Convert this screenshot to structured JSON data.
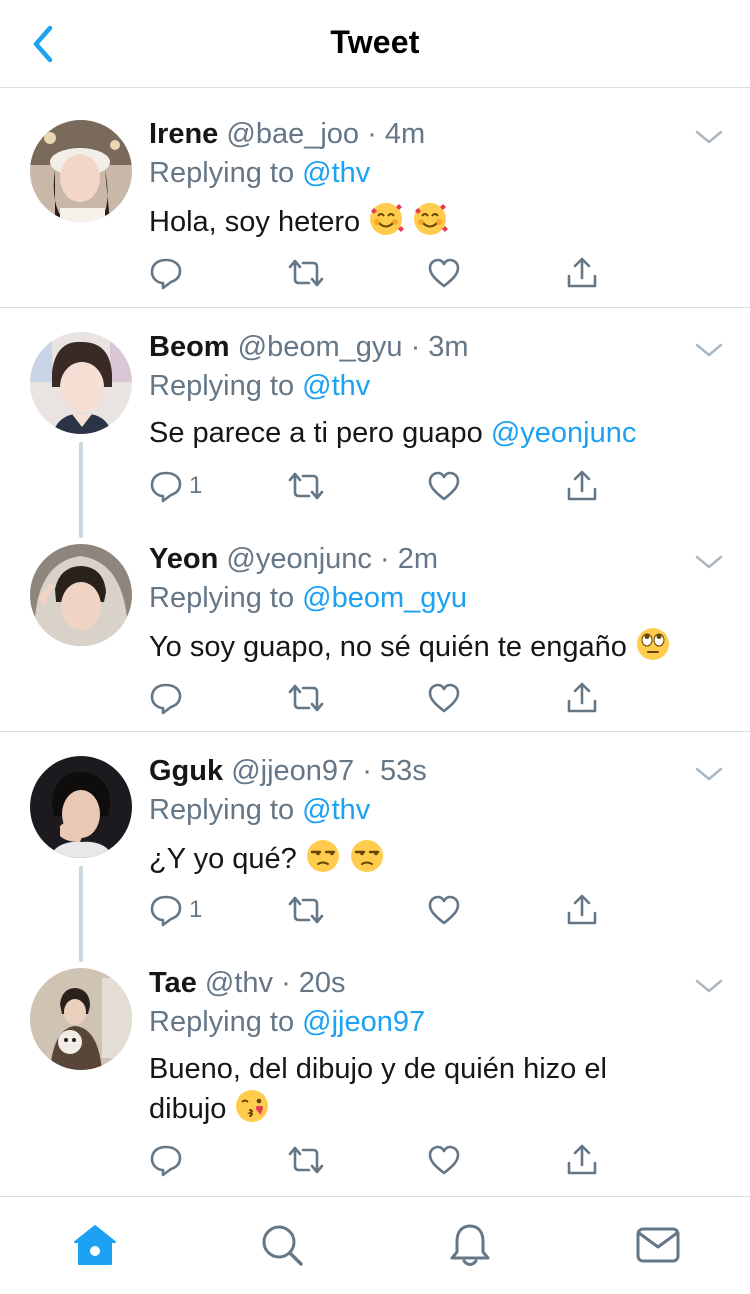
{
  "header": {
    "title": "Tweet",
    "back_icon": "chevron-left-icon"
  },
  "colors": {
    "accent": "#1da1f2",
    "muted": "#657786",
    "divider": "#d8dde2",
    "text": "#14171a"
  },
  "tweets": [
    {
      "name": "Irene",
      "handle": "@bae_joo",
      "time": "4m",
      "replying_label": "Replying to",
      "replying_to": "@thv",
      "text": "Hola, soy hetero",
      "emojis": [
        "smiling-face-with-hearts",
        "smiling-face-with-hearts"
      ],
      "reply_count": ""
    },
    {
      "name": "Beom",
      "handle": "@beom_gyu",
      "time": "3m",
      "replying_label": "Replying to",
      "replying_to": "@thv",
      "text": "Se parece a ti pero guapo",
      "text_mention": "@yeonjunc",
      "reply_count": "1"
    },
    {
      "name": "Yeon",
      "handle": "@yeonjunc",
      "time": "2m",
      "replying_label": "Replying to",
      "replying_to": "@beom_gyu",
      "text": "Yo soy guapo, no sé quién te engaño",
      "emojis": [
        "face-with-rolling-eyes"
      ],
      "reply_count": ""
    },
    {
      "name": "Gguk",
      "handle": "@jjeon97",
      "time": "53s",
      "replying_label": "Replying to",
      "replying_to": "@thv",
      "text": "¿Y yo qué?",
      "emojis": [
        "unamused-face",
        "unamused-face"
      ],
      "reply_count": "1"
    },
    {
      "name": "Tae",
      "handle": "@thv",
      "time": "20s",
      "replying_label": "Replying to",
      "replying_to": "@jjeon97",
      "text_line1": "Bueno, del dibujo y de quién hizo el",
      "text_line2": "dibujo",
      "emojis": [
        "face-blowing-a-kiss"
      ],
      "reply_count": ""
    }
  ],
  "tabbar": {
    "items": [
      "home-icon",
      "search-icon",
      "notifications-icon",
      "messages-icon"
    ],
    "active": "home-icon"
  }
}
